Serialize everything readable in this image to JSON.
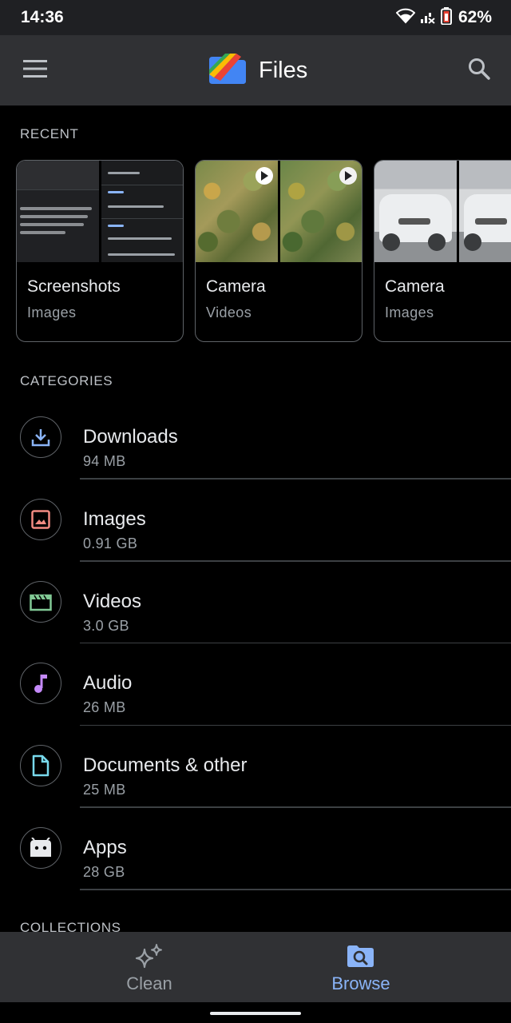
{
  "status_bar": {
    "time": "14:36",
    "battery": "62%",
    "icons": [
      "wifi-icon",
      "signal-off-icon",
      "battery-icon"
    ]
  },
  "app_bar": {
    "title": "Files",
    "icons": [
      "menu-icon",
      "files-logo-icon",
      "search-icon"
    ]
  },
  "recent": {
    "header": "RECENT",
    "cards": [
      {
        "title": "Screenshots",
        "subtitle": "Images"
      },
      {
        "title": "Camera",
        "subtitle": "Videos"
      },
      {
        "title": "Camera",
        "subtitle": "Images"
      }
    ]
  },
  "categories": {
    "header": "CATEGORIES",
    "items": [
      {
        "name": "Downloads",
        "size": "94 MB",
        "icon": "download-icon",
        "color": "#8ab4f8"
      },
      {
        "name": "Images",
        "size": "0.91 GB",
        "icon": "image-icon",
        "color": "#f28b82"
      },
      {
        "name": "Videos",
        "size": "3.0 GB",
        "icon": "video-icon",
        "color": "#81c995"
      },
      {
        "name": "Audio",
        "size": "26 MB",
        "icon": "music-note-icon",
        "color": "#c58af9"
      },
      {
        "name": "Documents & other",
        "size": "25 MB",
        "icon": "document-icon",
        "color": "#78d9ec"
      },
      {
        "name": "Apps",
        "size": "28 GB",
        "icon": "android-icon",
        "color": "#e8eaed"
      }
    ]
  },
  "collections": {
    "header": "COLLECTIONS"
  },
  "bottom_nav": {
    "items": [
      {
        "label": "Clean",
        "icon": "sparkle-icon",
        "active": false
      },
      {
        "label": "Browse",
        "icon": "browse-icon",
        "active": true
      }
    ],
    "active_color": "#8ab4f8",
    "inactive_color": "#9aa0a6"
  }
}
